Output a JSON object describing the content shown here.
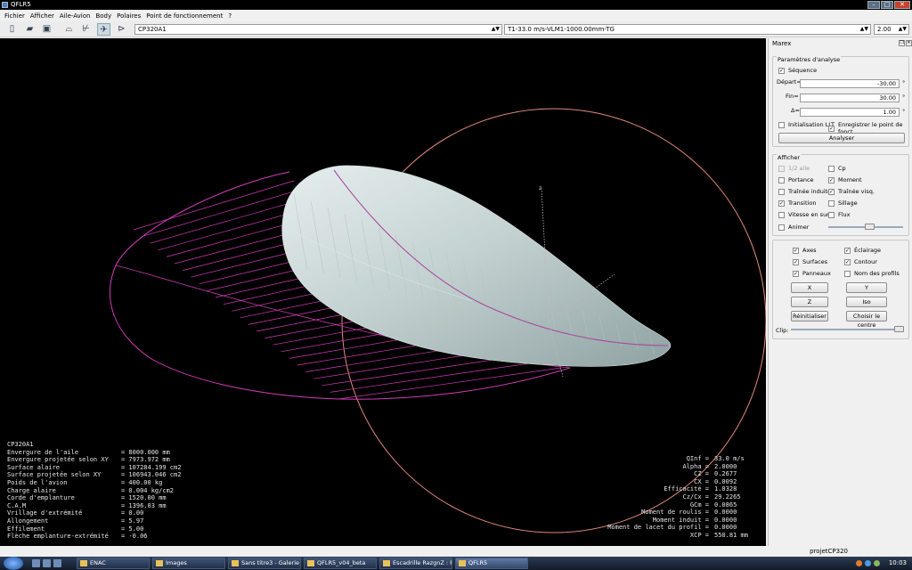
{
  "window": {
    "title": "QFLR5"
  },
  "menu": [
    "Fichier",
    "Afficher",
    "Aile-Avion",
    "Body",
    "Polaires",
    "Point de fonctionnement",
    "?"
  ],
  "toolbar": {
    "plane_select": "CP320A1",
    "polar_select": "T1-33.0 m/s-VLM1-1000.00mm-TG",
    "opp_select": "2.00",
    "icons": [
      "new-file-icon",
      "open-file-icon",
      "save-icon",
      "foil-view-icon",
      "polar-view-icon",
      "wing-view-icon",
      "plane-3d-view-icon"
    ]
  },
  "viewport": {
    "axis_label": "z",
    "colors": {
      "background": "#000000",
      "wing": "#c9d4d4",
      "circle": "#e08a7a",
      "panels": "#d33bb8"
    }
  },
  "info_left": {
    "plane_name": "CP320A1",
    "rows": [
      {
        "label": "Envergure de l'aile",
        "value": "= 8000.000 mm"
      },
      {
        "label": "Envergure projetée selon XY",
        "value": "= 7973.972 mm"
      },
      {
        "label": "Surface alaire",
        "value": "= 107284.199 cm2"
      },
      {
        "label": "Surface projetée selon XY",
        "value": "= 106943.046 cm2"
      },
      {
        "label": "Poids de l'avion",
        "value": "= 400.00 kg"
      },
      {
        "label": "Charge alaire",
        "value": "= 0.004 kg/cm2"
      },
      {
        "label": "Corde d'emplanture",
        "value": "= 1520.00 mm"
      },
      {
        "label": "C.A.M",
        "value": "= 1396.03 mm"
      },
      {
        "label": "Vrillage d'extrémité",
        "value": "= 0.00"
      },
      {
        "label": "Allongement",
        "value": "= 5.97"
      },
      {
        "label": "Effilement",
        "value": "= 5.00"
      },
      {
        "label": "Flèche emplanture-extrémité",
        "value": "= -0.06"
      }
    ]
  },
  "info_right": {
    "rows": [
      {
        "label": "QInf =",
        "value": "33.0 m/s"
      },
      {
        "label": "Alpha =",
        "value": "2.0000"
      },
      {
        "label": "CZ =",
        "value": "0.2677"
      },
      {
        "label": "CX =",
        "value": "0.0092"
      },
      {
        "label": "Efficacité =",
        "value": "1.0328"
      },
      {
        "label": "Cz/Cx =",
        "value": "29.2265"
      },
      {
        "label": "GCm =",
        "value": "0.0865"
      },
      {
        "label": "Moment de roulis =",
        "value": "0.0000"
      },
      {
        "label": "Moment induit =",
        "value": "0.0000"
      },
      {
        "label": "Moment de lacet du profil =",
        "value": "0.0000"
      },
      {
        "label": "XCP =",
        "value": "550.81 mm"
      }
    ]
  },
  "panel": {
    "title": "Marex",
    "analysis": {
      "group_title": "Paramètres d'analyse",
      "sequence_label": "Séquence",
      "depart_label": "Départ=",
      "depart_value": "-30.00",
      "fin_label": "Fin=",
      "fin_value": "30.00",
      "delta_label": "Δ=",
      "delta_value": "1.00",
      "unit": "°",
      "init_llt_label": "Initialisation LLT",
      "save_opp_label": "Enregistrer le point de fonct.",
      "analyze_button": "Analyser"
    },
    "display": {
      "group_title": "Afficher",
      "half_wing": "1/2 aile",
      "cp": "Cp",
      "lift": "Portance",
      "moment": "Moment",
      "induced_drag": "Traînée induite",
      "visc_drag": "Traînée visq.",
      "transition": "Transition",
      "wake": "Sillage",
      "surf_vel": "Vitesse en surf.",
      "flow": "Flux",
      "animate": "Animer",
      "animate_speed": 0.55
    },
    "view": {
      "axes": "Axes",
      "lighting": "Éclairage",
      "surfaces": "Surfaces",
      "outline": "Contour",
      "panels": "Panneaux",
      "foil_names": "Nom des profils",
      "x_button": "X",
      "y_button": "Y",
      "z_button": "Z",
      "iso_button": "Iso",
      "reset_button": "Réinitialiser",
      "center_button": "Choisir le centre",
      "clip_label": "Clip:",
      "clip_level": 0.97
    }
  },
  "status": {
    "project": "projetCP320"
  },
  "taskbar": {
    "tasks": [
      "ENAC",
      "Images",
      "Sans titre3 - Galerie ...",
      "QFLR5_v04_beta",
      "Escadrille RazgnZ : F...",
      "QFLR5"
    ],
    "clock": "10:03"
  }
}
